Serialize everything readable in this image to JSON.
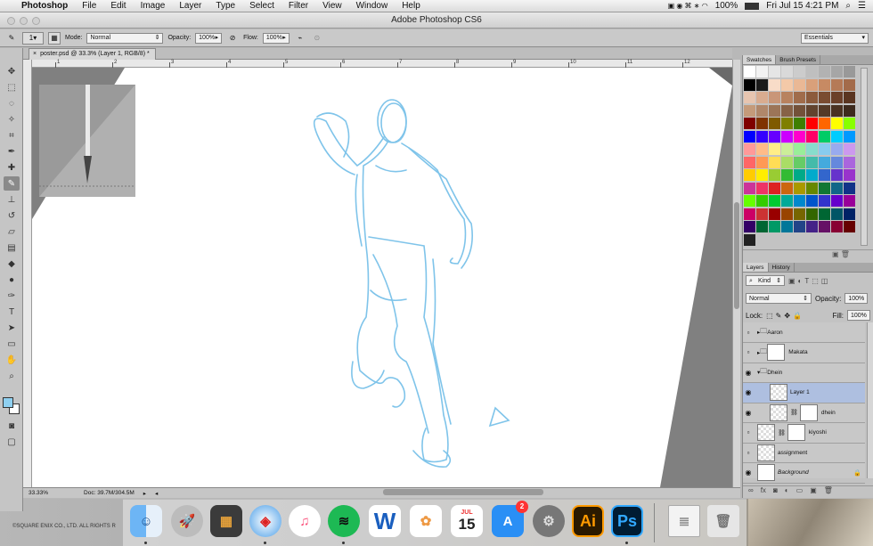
{
  "menubar": {
    "apple": "",
    "app": "Photoshop",
    "items": [
      "File",
      "Edit",
      "Image",
      "Layer",
      "Type",
      "Select",
      "Filter",
      "View",
      "Window",
      "Help"
    ],
    "battery": "100%",
    "datetime": "Fri Jul 15  4:21 PM"
  },
  "titlebar": {
    "title": "Adobe Photoshop CS6"
  },
  "options": {
    "mode_label": "Mode:",
    "mode": "Normal",
    "opacity_label": "Opacity:",
    "opacity": "100%",
    "flow_label": "Flow:",
    "flow": "100%",
    "brush_size": "1",
    "workspace": "Essentials"
  },
  "document": {
    "tab_title": "poster.psd @ 33.3% (Layer 1, RGB/8) *"
  },
  "ruler": {
    "h_ticks": [
      "1",
      "2",
      "3",
      "4",
      "5",
      "6",
      "7",
      "8",
      "9",
      "10",
      "11",
      "12"
    ]
  },
  "status": {
    "zoom": "33.33%",
    "doc": "Doc: 39.7M/304.5M"
  },
  "panels": {
    "swatches_tab": "Swatches",
    "brush_tab": "Brush Presets",
    "layers_tab": "Layers",
    "history_tab": "History",
    "kind": "Kind",
    "blend": "Normal",
    "opacity_label": "Opacity:",
    "opacity": "100%",
    "lock_label": "Lock:",
    "fill_label": "Fill:",
    "fill": "100%"
  },
  "swatch_colors": [
    "#ffffff",
    "#f2f2f2",
    "#e5e5e5",
    "#d9d9d9",
    "#cccccc",
    "#bfbfbf",
    "#b2b2b2",
    "#a6a6a6",
    "#999999",
    "#000000",
    "#1a1a1a",
    "#f8dcc8",
    "#f4c9a8",
    "#eab895",
    "#d9a07a",
    "#c78a63",
    "#b57a57",
    "#a36b4a",
    "#e7c5b0",
    "#d9ac90",
    "#c99678",
    "#b8825f",
    "#a06c4b",
    "#8c5b3c",
    "#7a4c31",
    "#6b4029",
    "#5a3520",
    "#c49a7a",
    "#b0876a",
    "#9c7558",
    "#876247",
    "#735139",
    "#61432e",
    "#553a27",
    "#4a3222",
    "#3d2a1d",
    "#7f0000",
    "#7f3300",
    "#7f5a00",
    "#7f7f00",
    "#3f7f00",
    "#ff0000",
    "#ff6600",
    "#ffff00",
    "#88ff00",
    "#0000ff",
    "#3300ff",
    "#6600ff",
    "#cc00ff",
    "#ff00cc",
    "#ff0066",
    "#00cc66",
    "#00ccff",
    "#0099ff",
    "#ff9999",
    "#ffbb88",
    "#ffee88",
    "#ccee99",
    "#99ee99",
    "#88ddcc",
    "#88ccee",
    "#99aaee",
    "#cc99ee",
    "#ff6666",
    "#ff9955",
    "#ffdd55",
    "#aadd66",
    "#66cc66",
    "#44bbaa",
    "#44aadd",
    "#6688dd",
    "#aa66dd",
    "#ffcc00",
    "#ffee00",
    "#99cc33",
    "#33bb33",
    "#00aa88",
    "#00aacc",
    "#3366cc",
    "#6633cc",
    "#9933cc",
    "#cc3399",
    "#ee3366",
    "#dd2222",
    "#cc6611",
    "#aa9900",
    "#668800",
    "#117733",
    "#116688",
    "#113388",
    "#66ff00",
    "#33cc00",
    "#00cc33",
    "#00aa99",
    "#0088cc",
    "#0055cc",
    "#3333cc",
    "#6600cc",
    "#990099",
    "#cc0066",
    "#cc3333",
    "#990000",
    "#994400",
    "#776600",
    "#336600",
    "#006633",
    "#005566",
    "#002266",
    "#330066",
    "#006633",
    "#009966",
    "#007799",
    "#224488",
    "#442288",
    "#661166",
    "#880033",
    "#660000",
    "#222222"
  ],
  "layers": [
    {
      "name": "Aaron",
      "type": "group",
      "visible": false,
      "indent": 0
    },
    {
      "name": "Makata",
      "type": "group-mask",
      "visible": false,
      "indent": 0
    },
    {
      "name": "Dhein",
      "type": "group-open",
      "visible": true,
      "indent": 0
    },
    {
      "name": "Layer 1",
      "type": "layer",
      "visible": true,
      "indent": 1,
      "selected": true
    },
    {
      "name": "dhein",
      "type": "masked",
      "visible": true,
      "indent": 1
    },
    {
      "name": "kiyoshi",
      "type": "masked",
      "visible": false,
      "indent": 0
    },
    {
      "name": "assignment",
      "type": "layer",
      "visible": false,
      "indent": 0
    },
    {
      "name": "Background",
      "type": "bg",
      "visible": true,
      "indent": 0
    }
  ],
  "desktop": {
    "copyright": "©SQUARE ENIX CO., LTD.  ALL RIGHTS R"
  },
  "dock": {
    "calendar_month": "JUL",
    "calendar_day": "15",
    "appstore_badge": "2",
    "ai": "Ai",
    "ps": "Ps"
  }
}
